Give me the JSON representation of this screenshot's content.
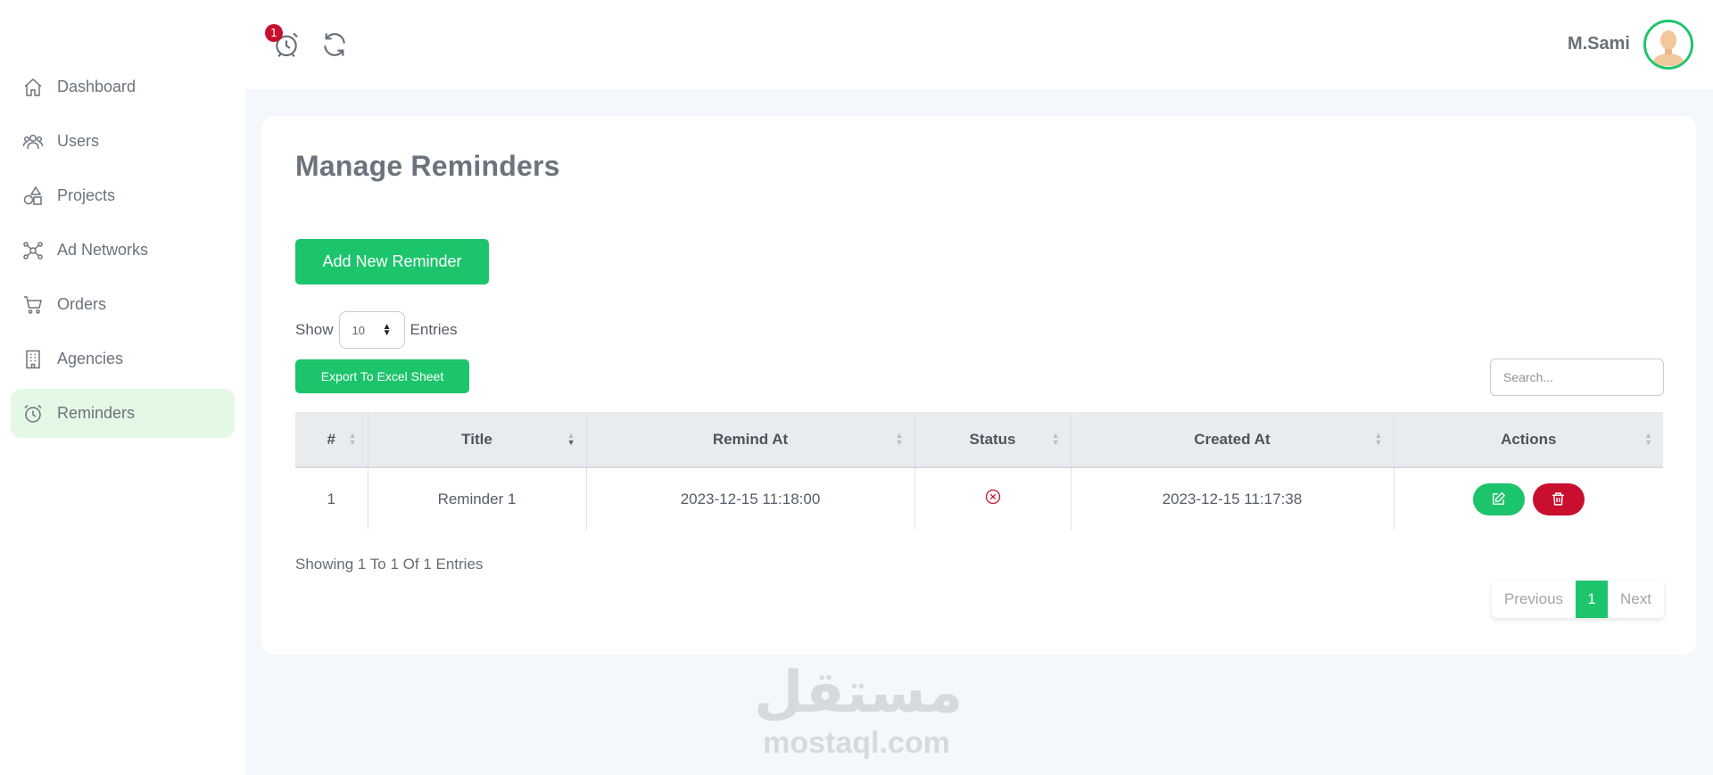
{
  "sidebar": {
    "items": [
      {
        "label": "Dashboard",
        "icon": "home-icon"
      },
      {
        "label": "Users",
        "icon": "users-icon"
      },
      {
        "label": "Projects",
        "icon": "shapes-icon"
      },
      {
        "label": "Ad Networks",
        "icon": "network-icon"
      },
      {
        "label": "Orders",
        "icon": "cart-icon"
      },
      {
        "label": "Agencies",
        "icon": "building-icon"
      },
      {
        "label": "Reminders",
        "icon": "alarm-clock-icon",
        "active": true
      }
    ]
  },
  "topbar": {
    "notification_count": "1",
    "username": "M.Sami"
  },
  "page": {
    "title": "Manage Reminders",
    "add_button": "Add New Reminder",
    "show_label": "Show",
    "entries_value": "10",
    "entries_label": "Entries",
    "export_button": "Export To Excel Sheet",
    "search_placeholder": "Search..."
  },
  "table": {
    "headers": [
      "#",
      "Title",
      "Remind At",
      "Status",
      "Created At",
      "Actions"
    ],
    "rows": [
      {
        "num": "1",
        "title": "Reminder 1",
        "remind_at": "2023-12-15 11:18:00",
        "status": "not-done",
        "created_at": "2023-12-15 11:17:38"
      }
    ]
  },
  "footer": {
    "showing": "Showing 1 To 1 Of 1 Entries",
    "prev": "Previous",
    "current_page": "1",
    "next": "Next"
  },
  "watermark": {
    "arabic": "مستقل",
    "latin": "mostaql.com"
  },
  "colors": {
    "accent_green": "#1cc46b",
    "danger_red": "#c8102e",
    "active_bg": "#e4f8e6"
  }
}
